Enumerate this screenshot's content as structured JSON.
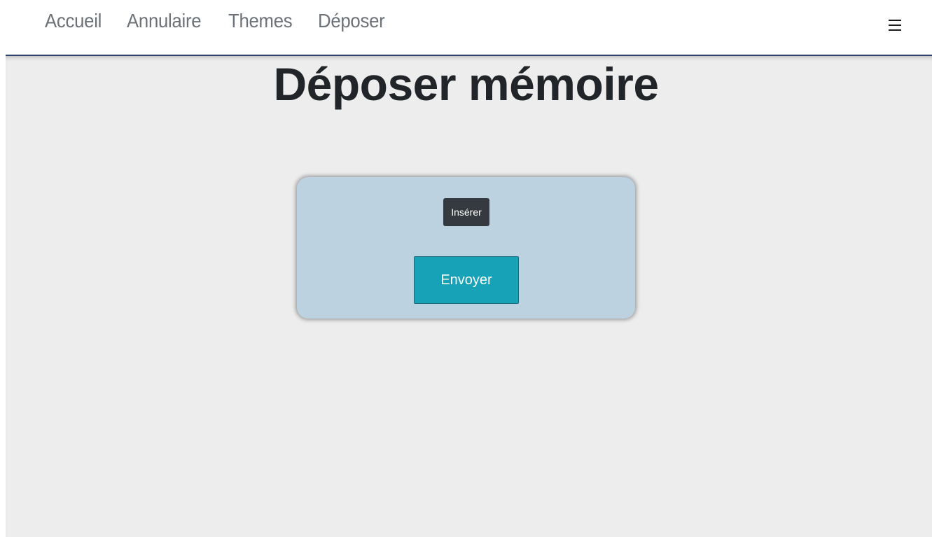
{
  "nav": {
    "links": [
      "Accueil",
      "Annulaire",
      "Themes",
      "Déposer"
    ],
    "menu_icon": "hamburger-menu-icon"
  },
  "main": {
    "title": "Déposer mémoire",
    "upload_form": {
      "insert_label": "Insérer",
      "submit_label": "Envoyer"
    }
  },
  "colors": {
    "nav_background": "#ffffff",
    "nav_text": "#6c7278",
    "nav_border": "#2f4371",
    "page_background": "#ededed",
    "card_background": "#bcd2e0",
    "insert_button": "#343a40",
    "submit_button": "#17a2b8",
    "title_text": "#212529"
  }
}
